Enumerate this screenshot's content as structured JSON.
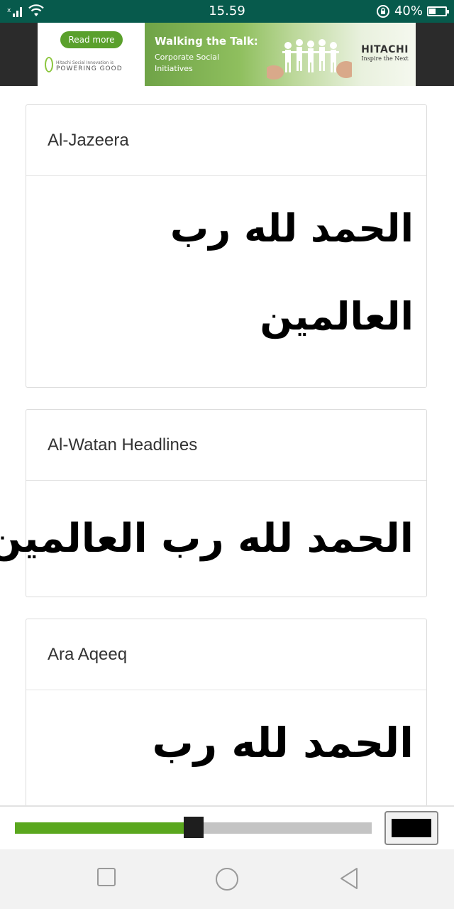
{
  "status_bar": {
    "signal_extra": "x",
    "time": "15.59",
    "battery_text": "40%",
    "battery_level": 0.4,
    "icons": [
      "signal-icon",
      "wifi-icon",
      "rotation-lock-icon",
      "battery-icon"
    ]
  },
  "ad": {
    "button_label": "Read more",
    "tagline_small": "Hitachi Social Innovation is",
    "tagline_large": "POWERING GOOD",
    "headline": "Walking the Talk:",
    "subhead": "Corporate Social Initiatives",
    "brand_name": "HITACHI",
    "brand_tag": "Inspire the Next",
    "accent_color": "#5aa02c"
  },
  "fonts": [
    {
      "name": "Al-Jazeera",
      "sample_lines": [
        "الحمد لله رب",
        "العالمين"
      ]
    },
    {
      "name": "Al-Watan Headlines",
      "sample_lines": [
        "الحمد لله رب العالمين"
      ]
    },
    {
      "name": "Ara Aqeeq",
      "sample_lines": [
        "الحمد لله رب"
      ]
    }
  ],
  "controls": {
    "size_slider_value": 0.5,
    "slider_color": "#5aa71e",
    "text_color": "#000000"
  },
  "navbar": {
    "icons": [
      "back-square-icon",
      "home-circle-icon",
      "recent-triangle-icon"
    ]
  }
}
